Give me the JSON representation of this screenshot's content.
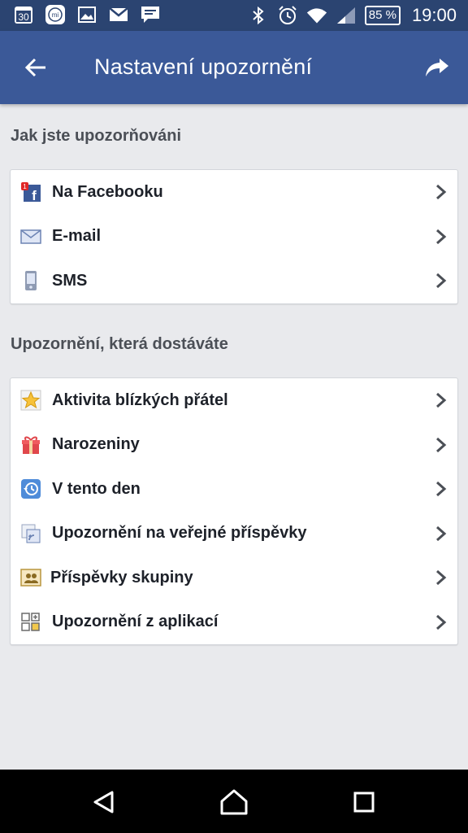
{
  "status_bar": {
    "calendar_day": "30",
    "battery": "85 %",
    "time": "19:00"
  },
  "app_bar": {
    "title": "Nastavení upozornění"
  },
  "section_how": {
    "header": "Jak jste upozorňováni",
    "items": [
      {
        "label": "Na Facebooku",
        "icon": "facebook-notification-icon"
      },
      {
        "label": "E-mail",
        "icon": "envelope-icon"
      },
      {
        "label": "SMS",
        "icon": "phone-icon"
      }
    ]
  },
  "section_what": {
    "header": "Upozornění, která dostáváte",
    "items": [
      {
        "label": "Aktivita blízkých přátel",
        "icon": "star-icon"
      },
      {
        "label": "Narozeniny",
        "icon": "gift-icon"
      },
      {
        "label": "V tento den",
        "icon": "history-clock-icon"
      },
      {
        "label": "Upozornění na veřejné příspěvky",
        "icon": "public-posts-icon"
      },
      {
        "label": "Příspěvky skupiny",
        "icon": "group-icon"
      },
      {
        "label": "Upozornění z aplikací",
        "icon": "apps-icon"
      }
    ]
  },
  "colors": {
    "status_bar": "#2b4471",
    "app_bar": "#3b5998",
    "background": "#e9eaed"
  }
}
